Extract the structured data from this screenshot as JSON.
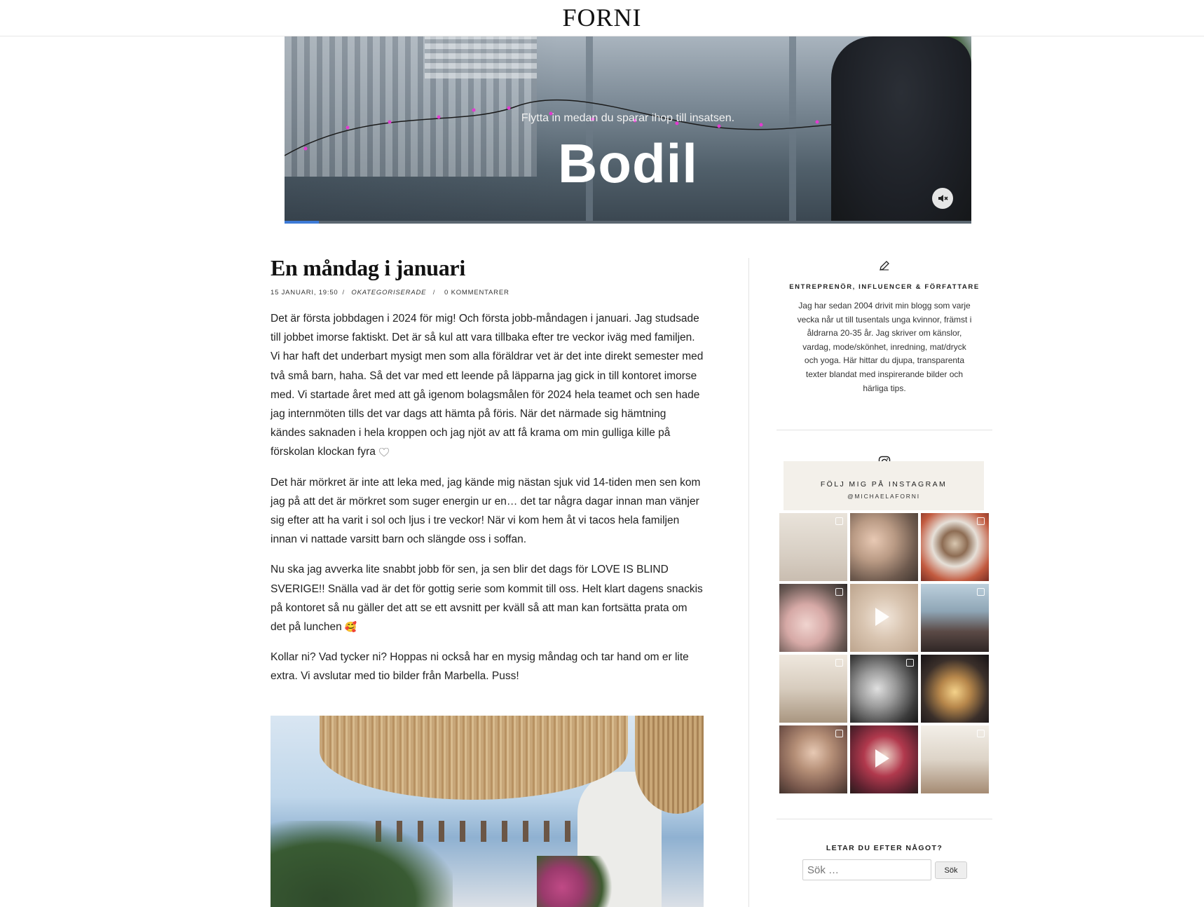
{
  "header": {
    "logo": "FORNI"
  },
  "banner": {
    "tagline": "Flytta in medan du sparar ihop till insatsen.",
    "brand": "Bodil",
    "mute_icon": "speaker-muted-icon",
    "progress": 0.05
  },
  "post": {
    "title": "En måndag i januari",
    "date": "15 januari, 19:50",
    "category": "Okategoriserade",
    "comments": "0 kommentarer",
    "paragraphs": [
      "Det är första jobbdagen i 2024 för mig! Och första jobb-måndagen i januari. Jag studsade till jobbet imorse faktiskt. Det är så kul att vara tillbaka efter tre veckor iväg med familjen. Vi har haft det underbart mysigt men som alla föräldrar vet är det inte direkt semester med två små barn, haha. Så det var med ett leende på läpparna jag gick in till kontoret imorse med. Vi startade året med att gå igenom bolagsmålen för 2024 hela teamet och sen hade jag internmöten tills det var dags att hämta på föris. När det närmade sig hämtning kändes saknaden i hela kroppen och jag njöt av att få krama om min gulliga kille på förskolan klockan fyra",
      "Det här mörkret är inte att leka med, jag kände mig nästan sjuk vid 14-tiden men sen kom jag på att det är mörkret som suger energin ur en… det tar några dagar innan man vänjer sig efter att ha varit i sol och ljus i tre veckor! När vi kom hem åt vi tacos hela familjen innan vi nattade varsitt barn och slängde oss i soffan.",
      "Nu ska jag avverka lite snabbt jobb för sen, ja sen blir det dags för LOVE IS BLIND SVERIGE!! Snälla vad är det för gottig serie som kommit till oss. Helt klart dagens snackis på kontoret så nu gäller det att se ett avsnitt per kväll så att man kan fortsätta prata om det på lunchen",
      "Kollar ni? Vad tycker ni? Hoppas ni också har en mysig måndag och tar hand om er lite extra. Vi avslutar med tio bilder från Marbella. Puss!"
    ],
    "emoji": "🥰"
  },
  "sidebar": {
    "role": "ENTREPRENÖR, INFLUENCER & FÖRFATTARE",
    "bio": "Jag har sedan 2004 drivit min blogg som varje vecka når ut till tusentals unga kvinnor, främst i åldrarna 20-35 år. Jag skriver om känslor, vardag, mode/skönhet, inredning, mat/dryck och yoga. Här hittar du djupa, transparenta texter blandat med inspirerande bilder och härliga tips.",
    "instagram": {
      "title": "FÖLJ MIG PÅ INSTAGRAM",
      "handle": "@MICHAELAFORNI"
    },
    "search": {
      "label": "LETAR DU EFTER NÅGOT?",
      "placeholder": "Sök …",
      "button": "Sök"
    }
  },
  "colors": {
    "accent_progress": "#3d7ad6",
    "ig_header_bg": "#f3f0ea"
  }
}
